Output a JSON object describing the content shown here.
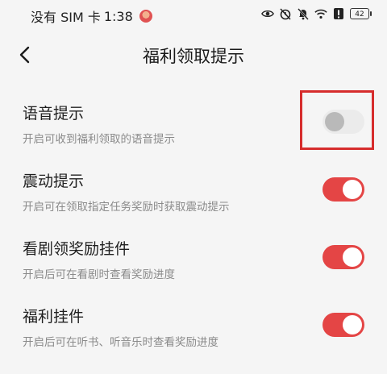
{
  "status_bar": {
    "carrier_text": "没有 SIM 卡",
    "time": "1:38",
    "battery_level": "42"
  },
  "header": {
    "title": "福利领取提示"
  },
  "settings": [
    {
      "title": "语音提示",
      "description": "开启可收到福利领取的语音提示",
      "enabled": false
    },
    {
      "title": "震动提示",
      "description": "开启可在领取指定任务奖励时获取震动提示",
      "enabled": true
    },
    {
      "title": "看剧领奖励挂件",
      "description": "开启后可在看剧时查看奖励进度",
      "enabled": true
    },
    {
      "title": "福利挂件",
      "description": "开启后可在听书、听音乐时查看奖励进度",
      "enabled": true
    }
  ],
  "colors": {
    "toggle_on": "#e44545",
    "toggle_off_track": "#ebebeb",
    "highlight": "#d62c2c"
  }
}
